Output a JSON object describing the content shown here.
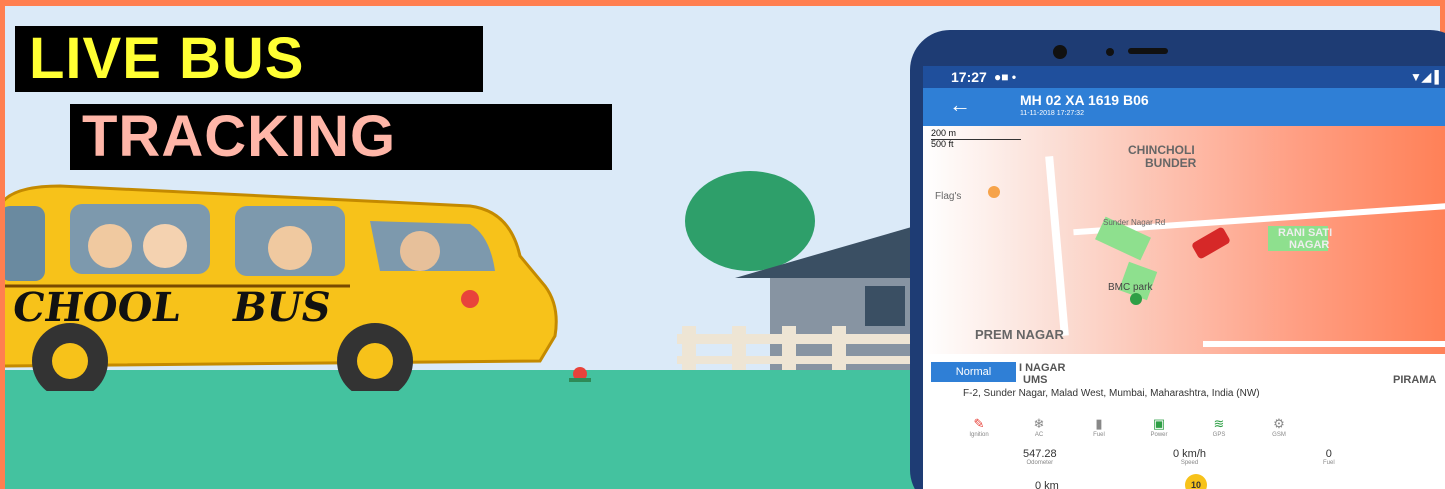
{
  "banner": {
    "line1": "LIVE BUS",
    "line2": "TRACKING"
  },
  "bus": {
    "side_text_1": "CHOOL",
    "side_text_2": "BUS"
  },
  "phone": {
    "status_time": "17:27",
    "vehicle_id": "MH 02 XA 1619 B06",
    "vehicle_time": "11-11-2018 17:27:32",
    "map": {
      "scale_m": "200 m",
      "scale_ft": "500 ft",
      "labels": [
        "CHINCHOLI",
        "BUNDER",
        "Flag's",
        "Sunder Nagar Rd",
        "RANI SATI",
        "NAGAR",
        "BMC park",
        "PREM NAGAR",
        "I NAGAR",
        "UMS",
        "PIRAMA"
      ]
    },
    "map_type_button": "Normal",
    "address": "F-2, Sunder Nagar, Malad West, Mumbai, Maharashtra, India (NW)",
    "sensors": [
      {
        "icon": "key-icon",
        "label": "Ignition"
      },
      {
        "icon": "snowflake-icon",
        "label": "AC"
      },
      {
        "icon": "fuel-icon",
        "label": "Fuel"
      },
      {
        "icon": "battery-icon",
        "label": "Power"
      },
      {
        "icon": "wifi-icon",
        "label": "GPS"
      },
      {
        "icon": "gear-icon",
        "label": "GSM"
      }
    ],
    "stats": [
      {
        "value": "547.28",
        "label": "Odometer"
      },
      {
        "value": "0 km/h",
        "label": "Speed"
      },
      {
        "value": "0",
        "label": "Fuel"
      }
    ],
    "bottom_value": "0 km",
    "speed_limit": "10"
  }
}
